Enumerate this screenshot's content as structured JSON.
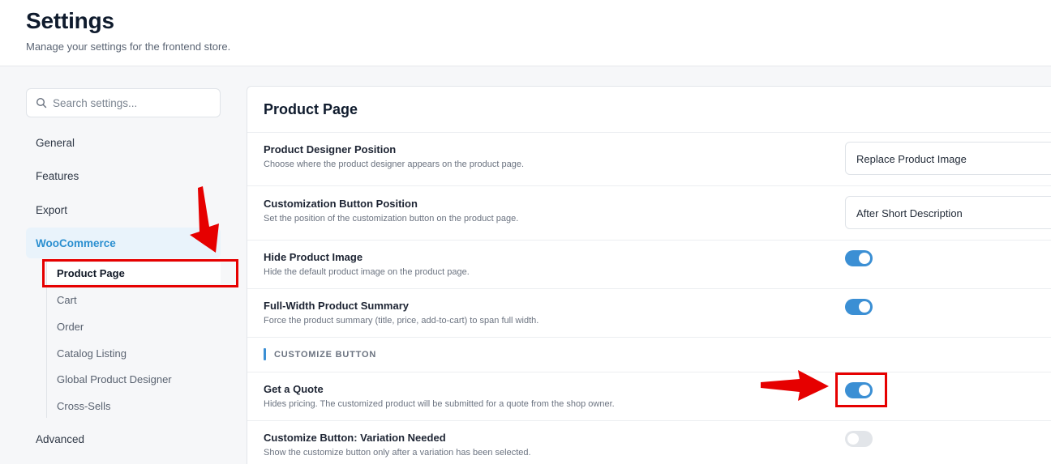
{
  "header": {
    "title": "Settings",
    "subtitle": "Manage your settings for the frontend store."
  },
  "sidebar": {
    "search_placeholder": "Search settings...",
    "items": {
      "general": "General",
      "features": "Features",
      "export": "Export",
      "woocommerce": "WooCommerce",
      "advanced": "Advanced"
    },
    "subitems": {
      "product_page": "Product Page",
      "cart": "Cart",
      "order": "Order",
      "catalog_listing": "Catalog Listing",
      "global_product_designer": "Global Product Designer",
      "cross_sells": "Cross-Sells"
    }
  },
  "panel": {
    "title": "Product Page",
    "rows": {
      "designer_position": {
        "label": "Product Designer Position",
        "description": "Choose where the product designer appears on the product page.",
        "value": "Replace Product Image"
      },
      "button_position": {
        "label": "Customization Button Position",
        "description": "Set the position of the customization button on the product page.",
        "value": "After Short Description"
      },
      "hide_image": {
        "label": "Hide Product Image",
        "description": "Hide the default product image on the product page.",
        "enabled": true
      },
      "full_width": {
        "label": "Full-Width Product Summary",
        "description": "Force the product summary (title, price, add-to-cart) to span full width.",
        "enabled": true
      },
      "section_title": "CUSTOMIZE BUTTON",
      "get_quote": {
        "label": "Get a Quote",
        "description": "Hides pricing. The customized product will be submitted for a quote from the shop owner.",
        "enabled": true
      },
      "variation_needed": {
        "label": "Customize Button: Variation Needed",
        "description": "Show the customize button only after a variation has been selected.",
        "enabled": false
      }
    }
  },
  "colors": {
    "accent": "#3b8fd4",
    "woo_active_text": "#2b8fd0",
    "annotation_red": "#e60000"
  }
}
